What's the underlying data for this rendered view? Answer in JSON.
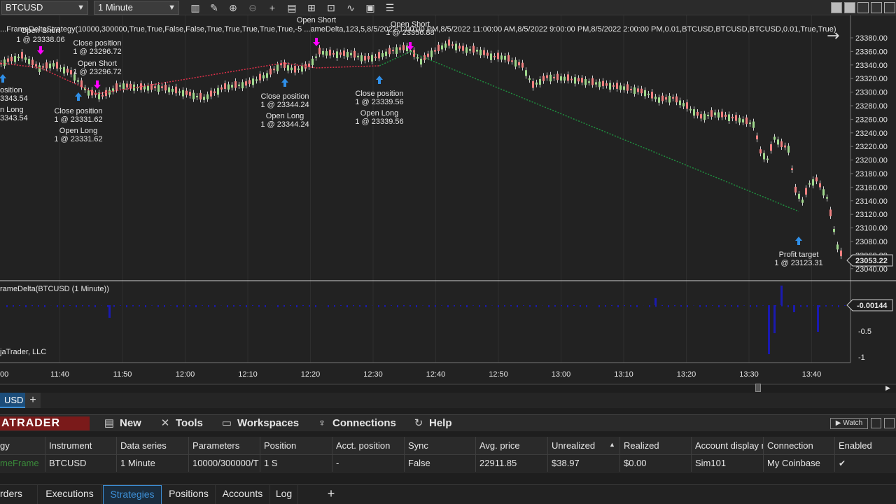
{
  "toolbar": {
    "instrument": "BTCUSD",
    "interval": "1 Minute",
    "icons": [
      "bar-type-icon",
      "pencil-icon",
      "zoom-in-icon",
      "zoom-out-icon",
      "crosshair-icon",
      "data-box-icon",
      "properties-icon",
      "strategy-icon",
      "indicator-icon",
      "template-icon",
      "list-icon"
    ]
  },
  "chart": {
    "strategy_label": "...FrameDeltaStrategy(10000,300000,True,True,False,False,True,True,True,True,True,-5 ...ameDelta,123,5,8/5/2022 1:00:00 PM,8/5/2022 11:00:00 AM,8/5/2022 9:00:00 PM,8/5/2022 2:00:00 PM,0.01,BTCUSD,BTCUSD,BTCUSD,0.01,True,True)",
    "indicator_label": "rameDelta(BTCUSD (1 Minute))",
    "copyright": "jaTrader, LLC",
    "current_price": "23053.22",
    "indicator_value": "-0.00144",
    "price_ticks": [
      "23380.00",
      "23360.00",
      "23340.00",
      "23320.00",
      "23300.00",
      "23280.00",
      "23260.00",
      "23240.00",
      "23220.00",
      "23200.00",
      "23180.00",
      "23160.00",
      "23140.00",
      "23120.00",
      "23100.00",
      "23080.00",
      "23060.00",
      "23040.00"
    ],
    "indicator_ticks": [
      "0",
      "-0.5",
      "-1"
    ],
    "time_ticks": [
      "00",
      "11:40",
      "11:50",
      "12:00",
      "12:10",
      "12:20",
      "12:30",
      "12:40",
      "12:50",
      "13:00",
      "13:10",
      "13:20",
      "13:30",
      "13:40"
    ],
    "annotations": {
      "open_short_a": "Open Short",
      "price_a": "1 @ 23338.06",
      "close_pos_b": "Close position",
      "price_b": "1 @ 23296.72",
      "open_short_b": "Open Short",
      "price_b2": "1 @ 23296.72",
      "close_pos_left": "osition",
      "price_left": "3343.54",
      "open_long_left": "n Long",
      "price_left2": "3343.54",
      "close_pos_c": "Close position",
      "price_c": "1 @ 23331.62",
      "open_long_c": "Open Long",
      "price_c2": "1 @ 23331.62",
      "close_pos_d": "Close position",
      "price_d": "1 @ 23344.24",
      "open_long_d": "Open Long",
      "price_d2": "1 @ 23344.24",
      "open_short_e": "Open Short",
      "price_e": "1 @ 23344.24",
      "close_pos_f": "Close position",
      "price_f": "1 @ 23339.56",
      "open_long_f": "Open Long",
      "price_f2": "1 @ 23339.56",
      "open_short_g": "Open Short",
      "price_g": "1 @ 23356.88",
      "profit_target": "Profit target",
      "price_pt": "1 @ 23123.31"
    }
  },
  "chart_tab": "USD",
  "menubar": {
    "brand": "ATRADER",
    "items": [
      {
        "label": "New",
        "icon": "new-icon"
      },
      {
        "label": "Tools",
        "icon": "tools-icon"
      },
      {
        "label": "Workspaces",
        "icon": "workspaces-icon"
      },
      {
        "label": "Connections",
        "icon": "connections-icon"
      },
      {
        "label": "Help",
        "icon": "help-icon"
      }
    ],
    "watch_label": "Watch"
  },
  "grid": {
    "columns": [
      "gy",
      "Instrument",
      "Data series",
      "Parameters",
      "Position",
      "Acct. position",
      "Sync",
      "Avg. price",
      "Unrealized",
      "Realized",
      "Account display n",
      "Connection",
      "Enabled"
    ],
    "rows": [
      {
        "strategy": "meFrame",
        "instrument": "BTCUSD",
        "data_series": "1 Minute",
        "parameters": "10000/300000/T",
        "position": "1 S",
        "acct_position": "-",
        "sync": "False",
        "avg_price": "22911.85",
        "unrealized": "$38.97",
        "realized": "$0.00",
        "account": "Sim101",
        "connection": "My Coinbase",
        "enabled": "✔"
      }
    ]
  },
  "bottom_tabs": [
    "rders",
    "Executions",
    "Strategies",
    "Positions",
    "Accounts",
    "Log"
  ],
  "colors": {
    "up_candle": "#9fd88c",
    "down_candle": "#f08080",
    "short_arrow": "#ff00ff",
    "long_arrow": "#2f8fe8",
    "brand": "#7a1a1a",
    "accent": "#3d8fd6"
  }
}
